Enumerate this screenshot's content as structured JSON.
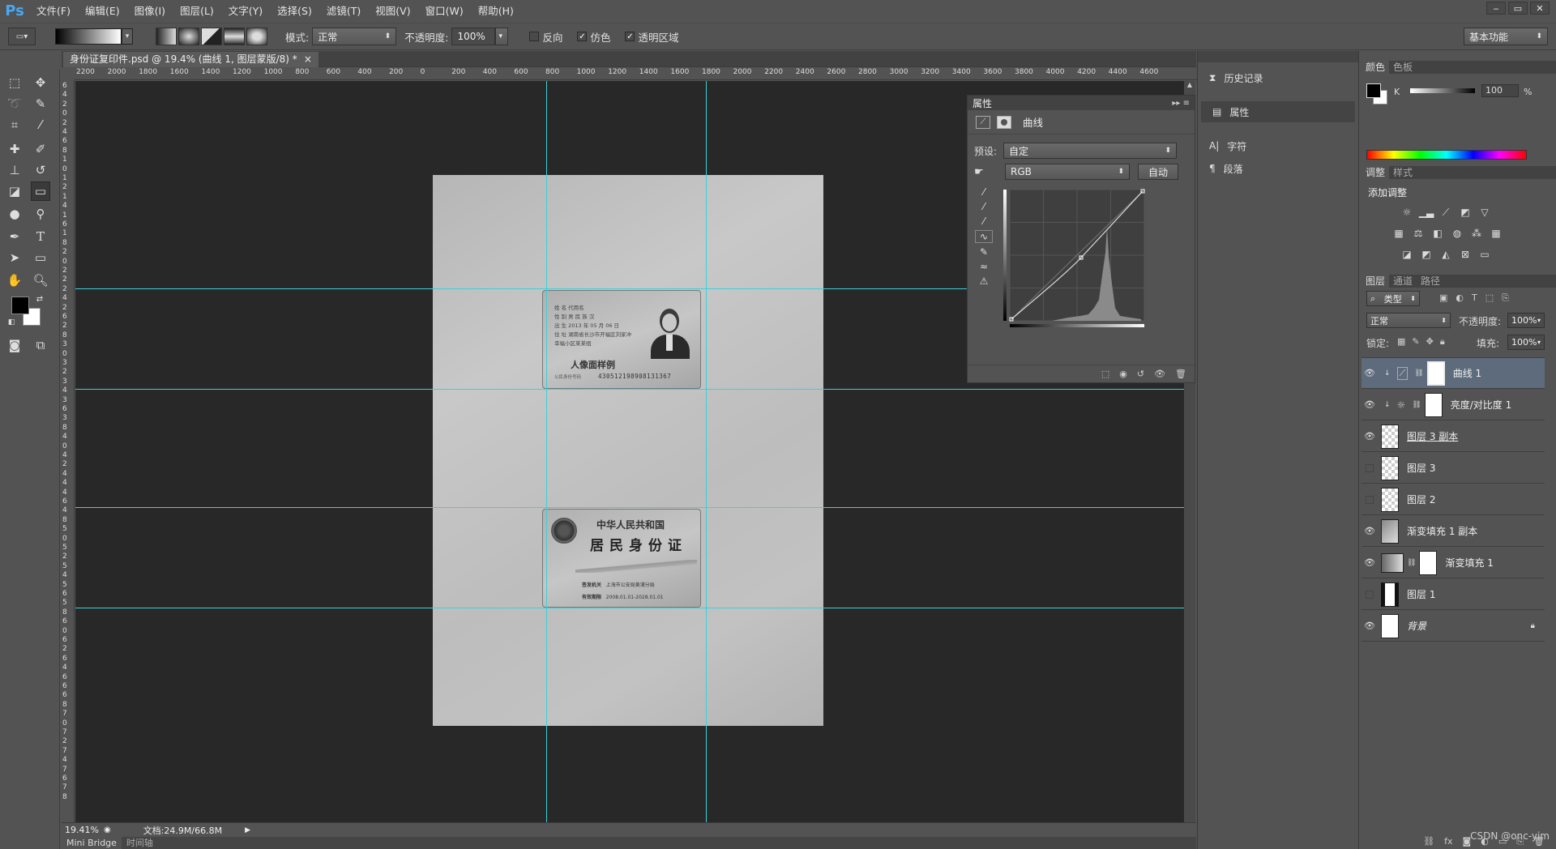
{
  "app": {
    "logo": "Ps"
  },
  "menu": [
    "文件(F)",
    "编辑(E)",
    "图像(I)",
    "图层(L)",
    "文字(Y)",
    "选择(S)",
    "滤镜(T)",
    "视图(V)",
    "窗口(W)",
    "帮助(H)"
  ],
  "window_controls": [
    "‒",
    "▭",
    "✕"
  ],
  "options": {
    "mode_label": "模式:",
    "mode_value": "正常",
    "opacity_label": "不透明度:",
    "opacity_value": "100%",
    "reverse_label": "反向",
    "dither_label": "仿色",
    "transparency_label": "透明区域",
    "workspace": "基本功能"
  },
  "document_tab": {
    "title": "身份证复印件.psd @ 19.4% (曲线 1, 图层蒙版/8) *",
    "close": "×"
  },
  "ruler_top": [
    "2200",
    "2000",
    "1800",
    "1600",
    "1400",
    "1200",
    "1000",
    "800",
    "600",
    "400",
    "200",
    "0",
    "200",
    "400",
    "600",
    "800",
    "1000",
    "1200",
    "1400",
    "1600",
    "1800",
    "2000",
    "2200",
    "2400",
    "2600",
    "2800",
    "3000",
    "3200",
    "3400",
    "3600",
    "3800",
    "4000",
    "4200",
    "4400",
    "4600"
  ],
  "ruler_left": [
    "6",
    "4",
    "2",
    "0",
    "2",
    "4",
    "6",
    "8",
    "1",
    "0",
    "1",
    "2",
    "1",
    "4",
    "1",
    "6",
    "1",
    "8",
    "2",
    "0",
    "2",
    "2",
    "2",
    "4",
    "2",
    "6",
    "2",
    "8",
    "3",
    "0",
    "3",
    "2",
    "3",
    "4",
    "3",
    "6",
    "3",
    "8",
    "4",
    "0",
    "4",
    "2",
    "4",
    "4",
    "4",
    "6",
    "4",
    "8",
    "5",
    "0",
    "5",
    "2",
    "5",
    "4",
    "5",
    "6",
    "5",
    "8",
    "6",
    "0",
    "6",
    "2",
    "6",
    "4",
    "6",
    "6",
    "6",
    "8",
    "7",
    "0",
    "7",
    "2",
    "7",
    "4",
    "7",
    "6",
    "7",
    "8"
  ],
  "id_front": {
    "lines": [
      "姓 名  代用名",
      "性 别  男   民 族  汉",
      "出 生  2013 年 05 月 06 日",
      "住 址  湖南省长沙市开福区刘家冲",
      "       幸福小区某某组"
    ],
    "caption": "人像面样例",
    "id_label": "公民身份号码",
    "id_number": "430512198908131367"
  },
  "id_back": {
    "title1": "中华人民共和国",
    "title2": "居民身份证",
    "authority_label": "签发机关",
    "authority_value": "上海市公安局黄浦分局",
    "validity_label": "有效期限",
    "validity_value": "2008.01.01-2028.01.01"
  },
  "status": {
    "zoom": "19.41%",
    "doc_info": "文档:24.9M/66.8M"
  },
  "bottom_tabs": [
    "Mini Bridge",
    "时间轴"
  ],
  "properties": {
    "tab": "属性",
    "type": "曲线",
    "preset_label": "预设:",
    "preset_value": "自定",
    "channel": "RGB",
    "auto": "自动"
  },
  "strip": {
    "history": "历史记录",
    "properties": "属性",
    "character": "字符",
    "paragraph": "段落"
  },
  "color_panel": {
    "tabs": [
      "颜色",
      "色板"
    ],
    "channel": "K",
    "value": "100",
    "unit": "%"
  },
  "adjust_panel": {
    "tabs": [
      "调整",
      "样式"
    ],
    "title": "添加调整"
  },
  "layers_panel": {
    "tabs": [
      "图层",
      "通道",
      "路径"
    ],
    "filter": "类型",
    "blend": "正常",
    "opacity_label": "不透明度:",
    "opacity_value": "100%",
    "lock_label": "锁定:",
    "fill_label": "填充:",
    "fill_value": "100%",
    "layers": [
      {
        "name": "曲线 1",
        "visible": true,
        "selected": true
      },
      {
        "name": "亮度/对比度 1",
        "visible": true,
        "selected": false
      },
      {
        "name": "图层 3 副本",
        "visible": true,
        "selected": false
      },
      {
        "name": "图层 3",
        "visible": false,
        "selected": false
      },
      {
        "name": "图层 2",
        "visible": false,
        "selected": false
      },
      {
        "name": "渐变填充 1 副本",
        "visible": true,
        "selected": false
      },
      {
        "name": "渐变填充 1",
        "visible": true,
        "selected": false
      },
      {
        "name": "图层 1",
        "visible": false,
        "selected": false
      },
      {
        "name": "背景",
        "visible": true,
        "selected": false
      }
    ]
  },
  "watermark": "CSDN @onc-yim",
  "colors": {
    "accent": "#4aa8f0",
    "guide": "#3ad1d8",
    "selected_layer": "#5d6b7c"
  }
}
